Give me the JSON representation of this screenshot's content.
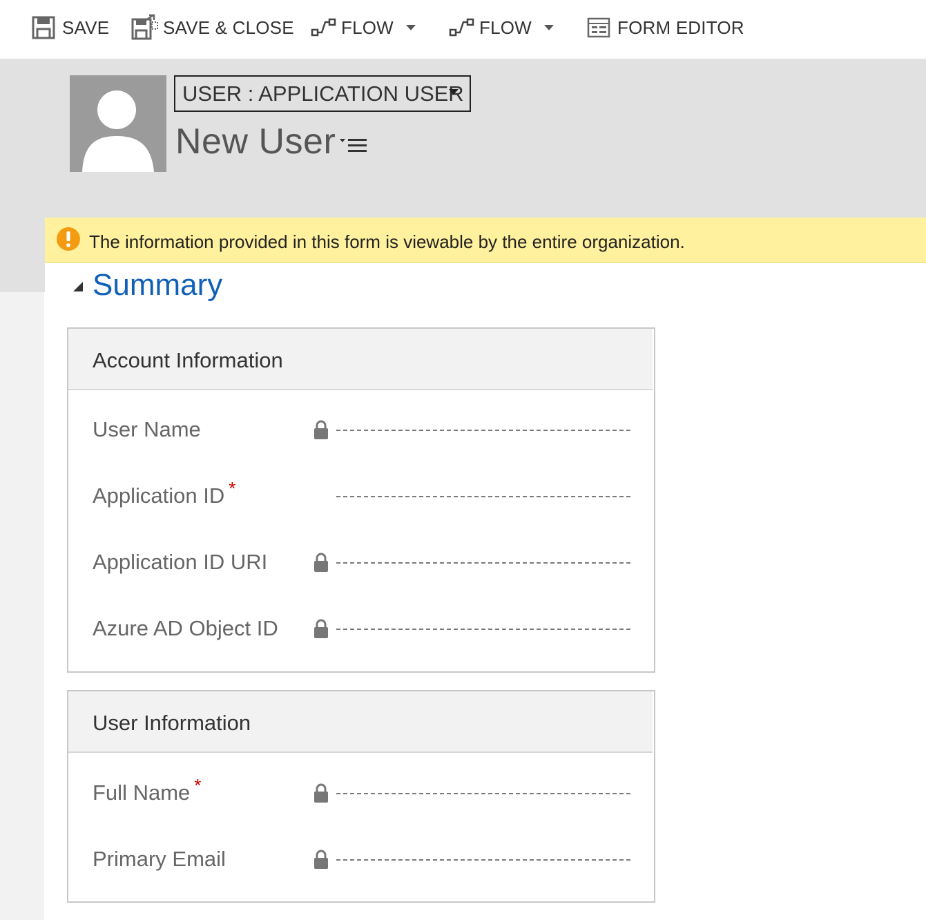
{
  "toolbar": {
    "save": {
      "label": "SAVE",
      "icon": "save-icon"
    },
    "save_close": {
      "label": "SAVE & CLOSE",
      "icon": "save-close-icon"
    },
    "flow1": {
      "label": "FLOW",
      "icon": "flow-icon"
    },
    "flow2": {
      "label": "FLOW",
      "icon": "flow-icon"
    },
    "form_editor": {
      "label": "FORM EDITOR",
      "icon": "form-editor-icon"
    }
  },
  "header": {
    "form_selector": "USER : APPLICATION USER",
    "record_title": "New User"
  },
  "notification": {
    "text": "The information provided in this form is viewable by the entire organization.",
    "icon": "warning-icon",
    "bg_color": "#fff19d"
  },
  "summary": {
    "title": "Summary",
    "account_information": {
      "title": "Account Information",
      "fields": [
        {
          "label": "User Name",
          "locked": true,
          "required": false,
          "value": ""
        },
        {
          "label": "Application ID",
          "locked": false,
          "required": true,
          "value": ""
        },
        {
          "label": "Application ID URI",
          "locked": true,
          "required": false,
          "value": ""
        },
        {
          "label": "Azure AD Object ID",
          "locked": true,
          "required": false,
          "value": ""
        }
      ]
    },
    "user_information": {
      "title": "User Information",
      "fields": [
        {
          "label": "Full Name",
          "locked": true,
          "required": true,
          "value": ""
        },
        {
          "label": "Primary Email",
          "locked": true,
          "required": false,
          "value": ""
        }
      ]
    }
  },
  "colors": {
    "accent": "#1160b7",
    "required": "#cc0000",
    "header_bg": "#e1e1e1"
  }
}
